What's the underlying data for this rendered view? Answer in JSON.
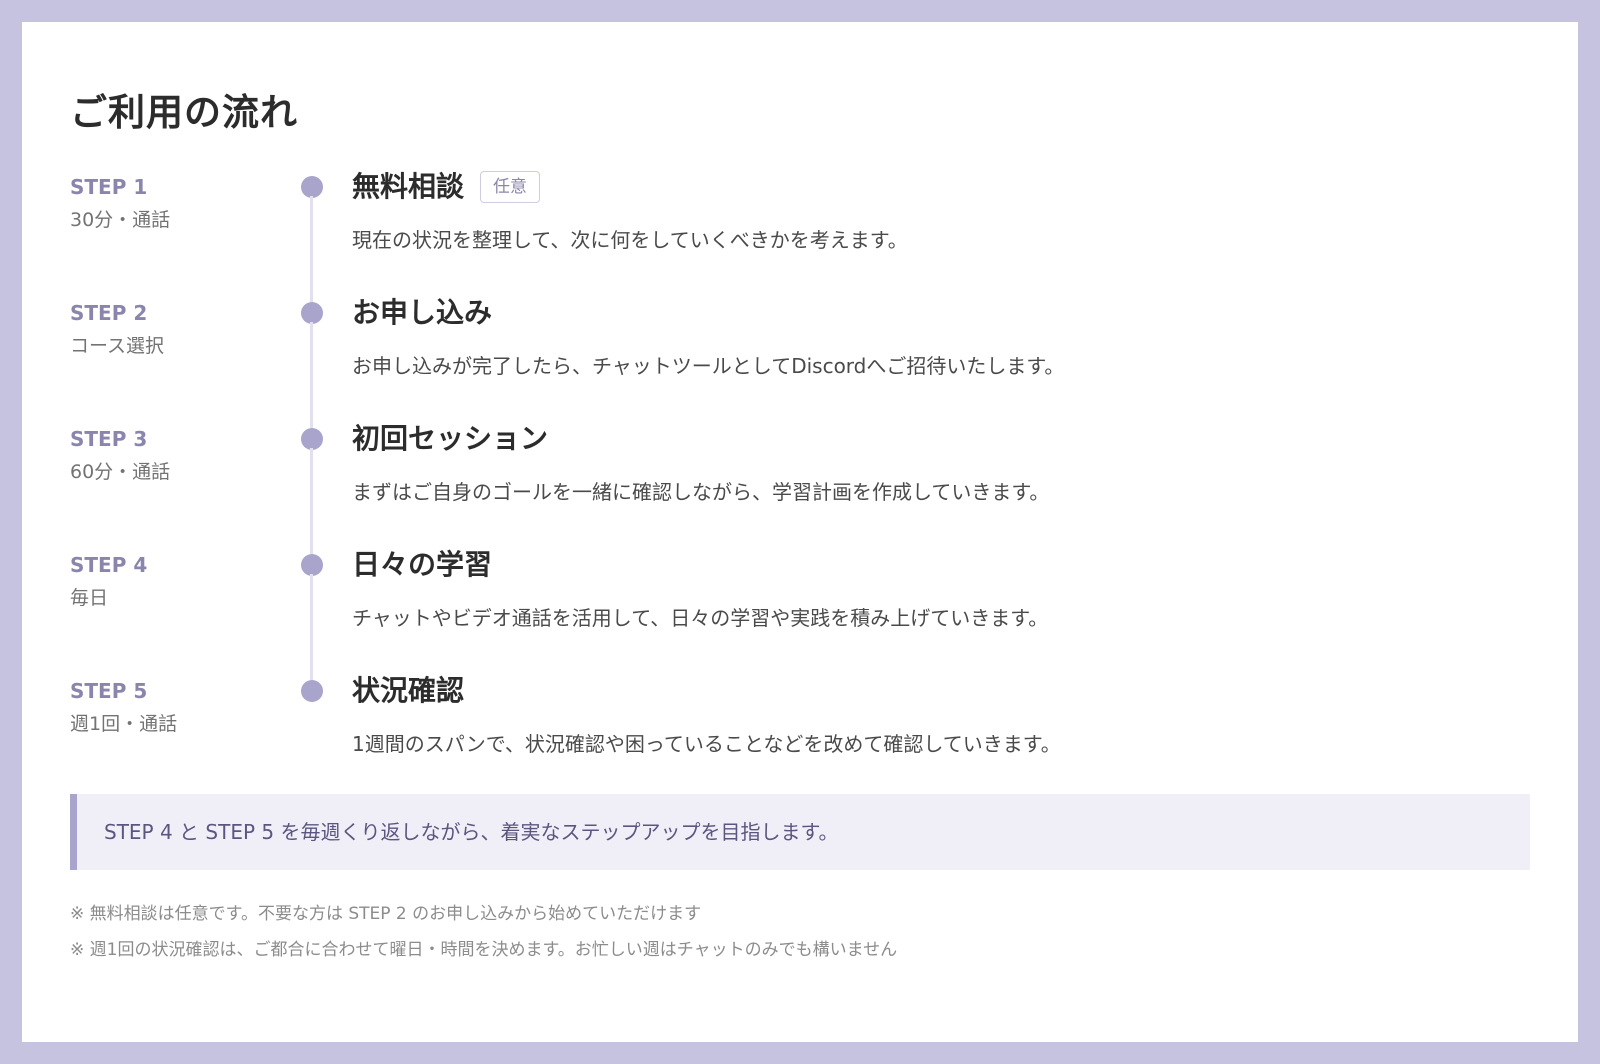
{
  "title": "ご利用の流れ",
  "steps": [
    {
      "label": "STEP 1",
      "sub": "30分・通話",
      "title": "無料相談",
      "badge": "任意",
      "desc": "現在の状況を整理して、次に何をしていくべきかを考えます。"
    },
    {
      "label": "STEP 2",
      "sub": "コース選択",
      "title": "お申し込み",
      "desc": "お申し込みが完了したら、チャットツールとしてDiscordへご招待いたします。"
    },
    {
      "label": "STEP 3",
      "sub": "60分・通話",
      "title": "初回セッション",
      "desc": "まずはご自身のゴールを一緒に確認しながら、学習計画を作成していきます。"
    },
    {
      "label": "STEP 4",
      "sub": "毎日",
      "title": "日々の学習",
      "desc": "チャットやビデオ通話を活用して、日々の学習や実践を積み上げていきます。"
    },
    {
      "label": "STEP 5",
      "sub": "週1回・通話",
      "title": "状況確認",
      "desc": "1週間のスパンで、状況確認や困っていることなどを改めて確認していきます。"
    }
  ],
  "note": "STEP 4 と STEP 5 を毎週くり返しながら、着実なステップアップを目指します。",
  "footnotes": [
    "※ 無料相談は任意です。不要な方は STEP 2 のお申し込みから始めていただけます",
    "※ 週1回の状況確認は、ご都合に合わせて曜日・時間を決めます。お忙しい週はチャットのみでも構いません"
  ],
  "colors": {
    "frame": "#c6c3e0",
    "accent": "#a8a4cc",
    "step_label": "#8a85ad",
    "note_bg": "#f0eff7"
  }
}
